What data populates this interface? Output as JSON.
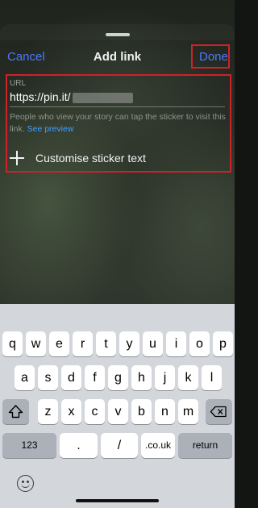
{
  "header": {
    "cancel_label": "Cancel",
    "title": "Add link",
    "done_label": "Done"
  },
  "form": {
    "url_label": "URL",
    "url_value": "https://pin.it/",
    "helper_text": "People who view your story can tap the sticker to visit this link.",
    "preview_link": "See preview",
    "customise_label": "Customise sticker text"
  },
  "keyboard": {
    "row1": [
      "q",
      "w",
      "e",
      "r",
      "t",
      "y",
      "u",
      "i",
      "o",
      "p"
    ],
    "row2": [
      "a",
      "s",
      "d",
      "f",
      "g",
      "h",
      "j",
      "k",
      "l"
    ],
    "row3": [
      "z",
      "x",
      "c",
      "v",
      "b",
      "n",
      "m"
    ],
    "numbers_label": "123",
    "dot_label": ".",
    "slash_label": "/",
    "couk_label": ".co.uk",
    "return_label": "return"
  },
  "colors": {
    "accent": "#4a79ff",
    "link": "#3fa0ff",
    "highlight_border": "#d0202a"
  }
}
